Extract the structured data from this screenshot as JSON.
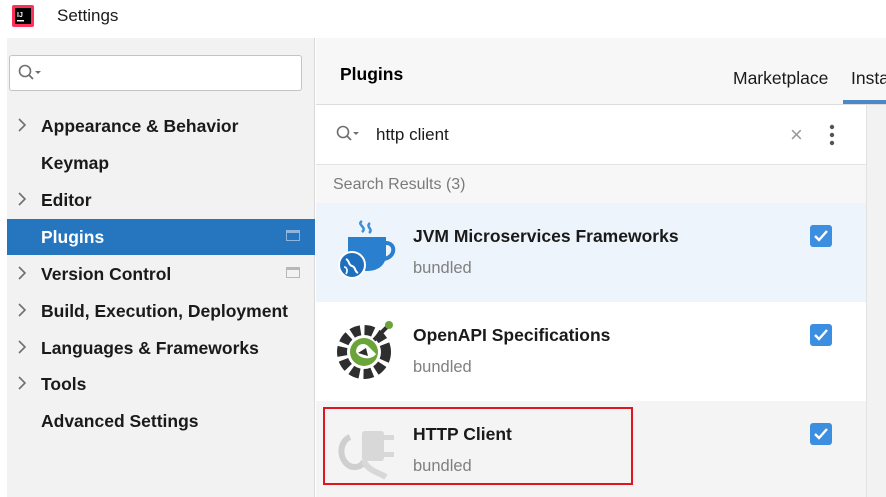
{
  "window": {
    "title": "Settings",
    "app_icon": "intellij-idea-icon"
  },
  "sidebar": {
    "search": {
      "value": "",
      "placeholder": ""
    },
    "items": [
      {
        "label": "Appearance & Behavior",
        "has_chevron": true,
        "selected": false,
        "project_icon": false
      },
      {
        "label": "Keymap",
        "has_chevron": false,
        "selected": false,
        "project_icon": false
      },
      {
        "label": "Editor",
        "has_chevron": true,
        "selected": false,
        "project_icon": false
      },
      {
        "label": "Plugins",
        "has_chevron": false,
        "selected": true,
        "project_icon": true
      },
      {
        "label": "Version Control",
        "has_chevron": true,
        "selected": false,
        "project_icon": true
      },
      {
        "label": "Build, Execution, Deployment",
        "has_chevron": true,
        "selected": false,
        "project_icon": false
      },
      {
        "label": "Languages & Frameworks",
        "has_chevron": true,
        "selected": false,
        "project_icon": false
      },
      {
        "label": "Tools",
        "has_chevron": true,
        "selected": false,
        "project_icon": false
      },
      {
        "label": "Advanced Settings",
        "has_chevron": false,
        "selected": false,
        "project_icon": false
      }
    ]
  },
  "header": {
    "title": "Plugins",
    "tabs": [
      {
        "label": "Marketplace",
        "active": false
      },
      {
        "label": "Insta",
        "active": true
      }
    ]
  },
  "search": {
    "value": "http client",
    "clear_icon": "close-icon",
    "more_icon": "more-vertical-icon"
  },
  "results": {
    "header": "Search Results (3)",
    "items": [
      {
        "name": "JVM Microservices Frameworks",
        "subtitle": "bundled",
        "checked": true,
        "icon": "jvm-microservices-icon"
      },
      {
        "name": "OpenAPI Specifications",
        "subtitle": "bundled",
        "checked": true,
        "icon": "openapi-icon"
      },
      {
        "name": "HTTP Client",
        "subtitle": "bundled",
        "checked": true,
        "icon": "http-client-plug-icon"
      }
    ]
  },
  "colors": {
    "selection": "#2675bf",
    "checkbox": "#3c8ee0",
    "highlight": "#e0151f",
    "tab_underline": "#4a88c7"
  }
}
